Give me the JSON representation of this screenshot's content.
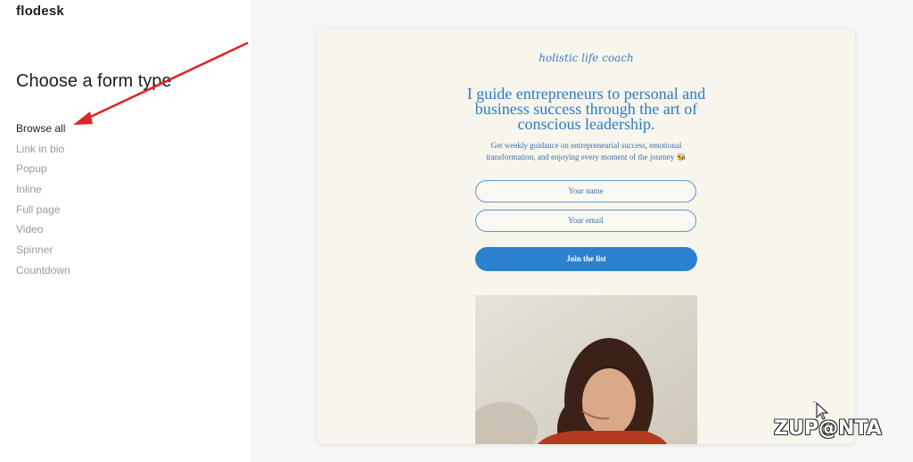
{
  "sidebar": {
    "logo": "flodesk",
    "heading": "Choose a form type",
    "items": [
      {
        "label": "Browse all",
        "active": true
      },
      {
        "label": "Link in bio",
        "active": false
      },
      {
        "label": "Popup",
        "active": false
      },
      {
        "label": "Inline",
        "active": false
      },
      {
        "label": "Full page",
        "active": false
      },
      {
        "label": "Video",
        "active": false
      },
      {
        "label": "Spinner",
        "active": false
      },
      {
        "label": "Countdown",
        "active": false
      }
    ]
  },
  "annotation": {
    "arrow_color": "#e02424",
    "points_to": "Browse all"
  },
  "preview": {
    "eyebrow": "holistic life coach",
    "headline": "I guide entrepreneurs to personal and business success through the art of conscious leadership.",
    "subtext": "Get weekly guidance on entrepreneurial success, emotional transformation, and enjoying every moment of the journey",
    "subtext_emoji": "bee-icon",
    "name_placeholder": "Your name",
    "email_placeholder": "Your email",
    "button_label": "Join the list",
    "accent_color": "#2a81cf",
    "background_color": "#f8f5ec"
  },
  "watermark": {
    "text": "ZUP@NTA"
  }
}
